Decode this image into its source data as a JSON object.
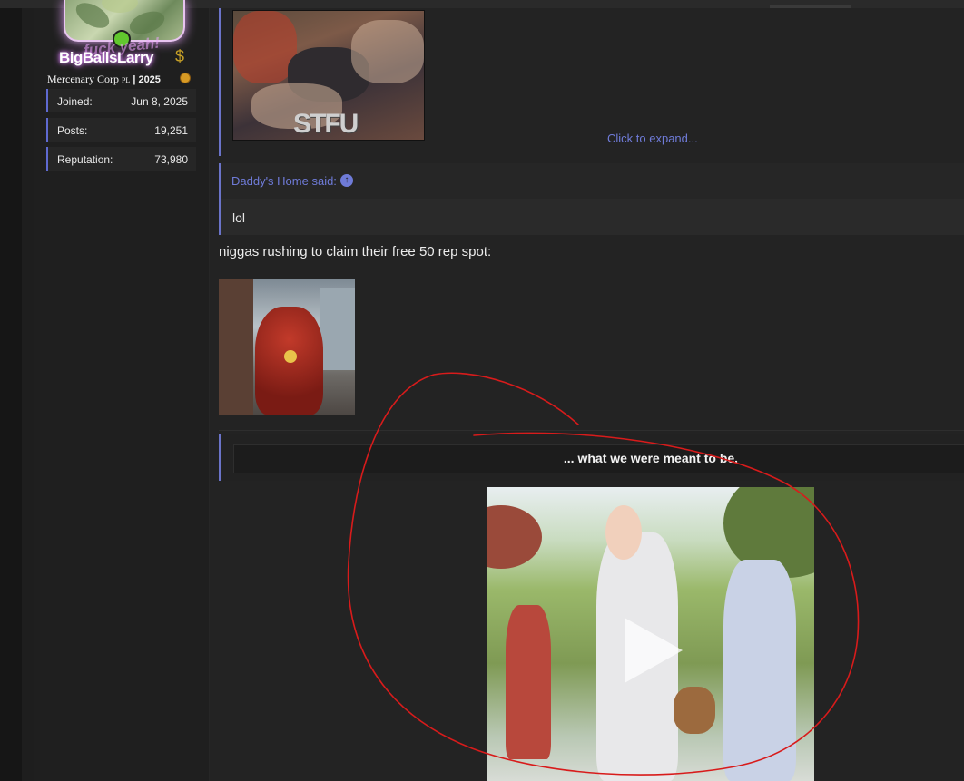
{
  "user": {
    "username": "BigBallsLarry",
    "username_deco": "fuck yeah!",
    "title": "Mercenary Corp",
    "title_tag": "PL",
    "title_year": "| 2025",
    "icons": [
      "dollar-icon",
      "medal-icon"
    ],
    "stats": [
      {
        "label": "Joined:",
        "value": "Jun 8, 2025"
      },
      {
        "label": "Posts:",
        "value": "19,251"
      },
      {
        "label": "Reputation:",
        "value": "73,980"
      }
    ]
  },
  "post": {
    "first_quote": {
      "image_caption": "STFU",
      "expand_label": "Click to expand..."
    },
    "second_quote": {
      "author": "Daddy's Home said:",
      "text": "lol"
    },
    "body_text": "niggas rushing to claim their free 50 rep spot:",
    "spoiler_title": "... what we were meant to be."
  },
  "colors": {
    "accent": "#6f7bd8",
    "quote_bar": "#6b74c9",
    "background": "#232323",
    "annotation": "#d81b1b"
  }
}
